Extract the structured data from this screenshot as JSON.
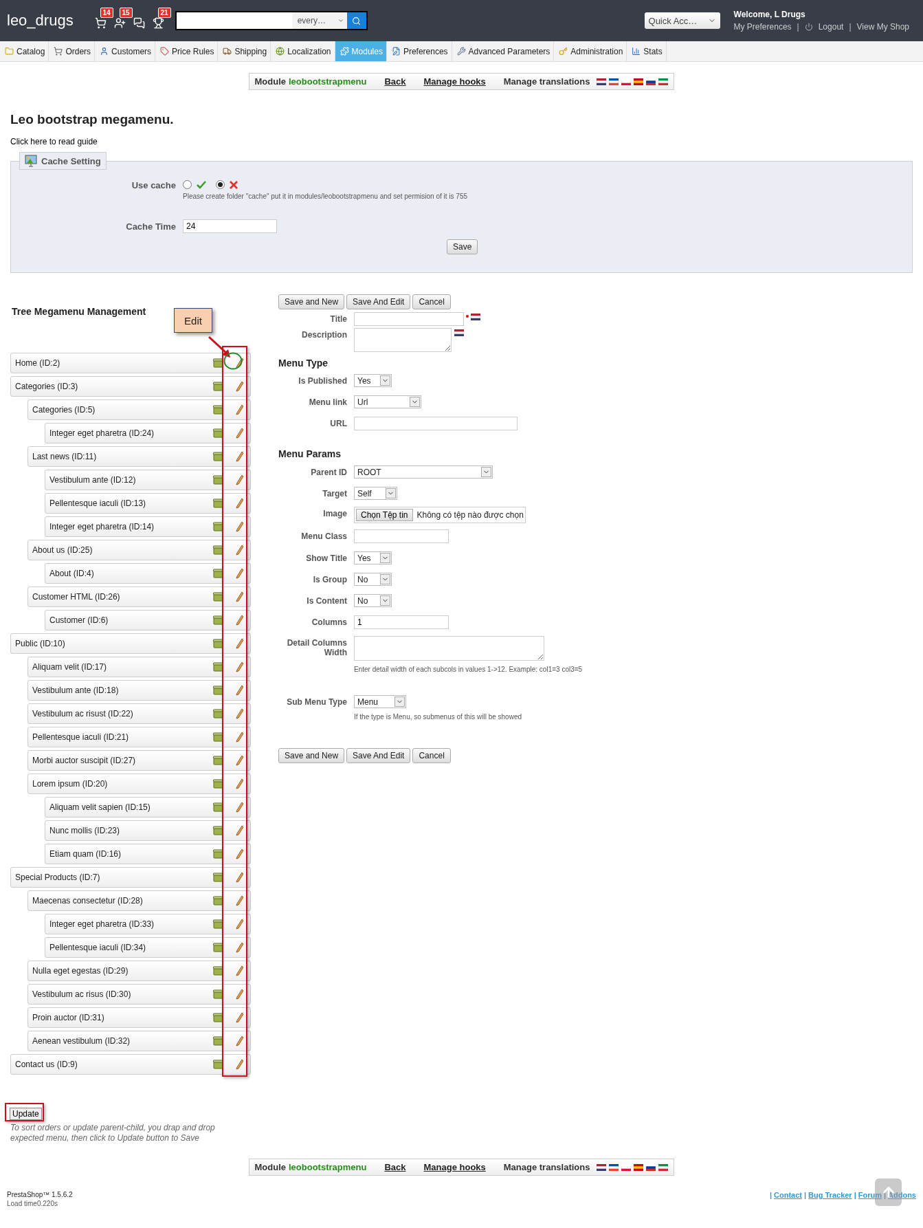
{
  "header": {
    "logo": "leo_drugs",
    "notifications": [
      {
        "kind": "cart",
        "count": "14"
      },
      {
        "kind": "customer",
        "count": "15"
      },
      {
        "kind": "message"
      },
      {
        "kind": "trophy",
        "count": "21"
      }
    ],
    "search": {
      "scope": "every…"
    },
    "quick_access": "Quick Acc…",
    "welcome": "Welcome, L Drugs",
    "separator": "|",
    "links": [
      "My Preferences",
      "Logout",
      "View My Shop"
    ]
  },
  "tabs": [
    {
      "label": "Catalog",
      "selected": false
    },
    {
      "label": "Orders",
      "selected": false
    },
    {
      "label": "Customers",
      "selected": false
    },
    {
      "label": "Price Rules",
      "selected": false
    },
    {
      "label": "Shipping",
      "selected": false
    },
    {
      "label": "Localization",
      "selected": false
    },
    {
      "label": "Modules",
      "selected": true
    },
    {
      "label": "Preferences",
      "selected": false
    },
    {
      "label": "Advanced Parameters",
      "selected": false
    },
    {
      "label": "Administration",
      "selected": false
    },
    {
      "label": "Stats",
      "selected": false
    }
  ],
  "module_bar_top": {
    "label": "Module",
    "module": "leobootstrapmenu",
    "links": [
      "Back",
      "Manage hooks"
    ],
    "translations": "Manage translations"
  },
  "title": "Leo bootstrap megamenu.",
  "guide_link": "Click here to read guide",
  "cache": {
    "legend": "Cache Setting",
    "use_cache_label": "Use cache",
    "options": [
      {
        "kind": "yes",
        "selected": false
      },
      {
        "kind": "no",
        "selected": true
      }
    ],
    "hint": "Please create folder \"cache\" put it in modules/leobootstrapmenu and set permision of it is 755",
    "time_label": "Cache Time",
    "time_value": "24",
    "save": "Save"
  },
  "tree": {
    "title": "Tree Megamenu Management",
    "items": [
      {
        "label": "Home (ID:2)"
      },
      {
        "label": "Categories (ID:3)",
        "children": [
          {
            "label": "Categories (ID:5)",
            "children": [
              {
                "label": "Integer eget pharetra (ID:24)"
              }
            ]
          },
          {
            "label": "Last news (ID:11)",
            "children": [
              {
                "label": "Vestibulum ante (ID:12)"
              },
              {
                "label": "Pellentesque iaculi (ID:13)"
              },
              {
                "label": "Integer eget pharetra (ID:14)"
              }
            ]
          },
          {
            "label": "About us (ID:25)",
            "children": [
              {
                "label": "About (ID:4)"
              }
            ]
          },
          {
            "label": "Customer HTML (ID:26)",
            "children": [
              {
                "label": "Customer (ID:6)"
              }
            ]
          }
        ]
      },
      {
        "label": "Public (ID:10)",
        "children": [
          {
            "label": "Aliquam velit (ID:17)"
          },
          {
            "label": "Vestibulum ante (ID:18)"
          },
          {
            "label": "Vestibulum ac risust (ID:22)"
          },
          {
            "label": "Pellentesque iaculi (ID:21)"
          },
          {
            "label": "Morbi auctor suscipit (ID:27)"
          },
          {
            "label": "Lorem ipsum (ID:20)",
            "children": [
              {
                "label": "Aliquam velit sapien (ID:15)"
              },
              {
                "label": "Nunc mollis (ID:23)"
              },
              {
                "label": "Etiam quam (ID:16)"
              }
            ]
          }
        ]
      },
      {
        "label": "Special Products (ID:7)",
        "children": [
          {
            "label": "Maecenas consectetur (ID:28)",
            "children": [
              {
                "label": "Integer eget pharetra (ID:33)"
              },
              {
                "label": "Pellentesque iaculi (ID:34)"
              }
            ]
          },
          {
            "label": "Nulla eget egestas (ID:29)"
          },
          {
            "label": "Vestibulum ac risus (ID:30)"
          },
          {
            "label": "Proin auctor (ID:31)"
          },
          {
            "label": "Aenean vestibulum (ID:32)"
          }
        ]
      },
      {
        "label": "Contact us (ID:9)"
      }
    ],
    "update": "Update",
    "note": "To sort orders or update parent-child, you drap and drop expected menu, then click to Update button to Save"
  },
  "callout": "Edit",
  "form": {
    "buttons_top": [
      "Save and New",
      "Save And Edit",
      "Cancel"
    ],
    "fields": [
      {
        "kind": "text",
        "label": "Title",
        "required": true,
        "flag": true
      },
      {
        "kind": "textarea",
        "label": "Description",
        "flag": true
      },
      {
        "kind": "heading",
        "label": "Menu Type"
      },
      {
        "kind": "select",
        "label": "Is Published",
        "value": "Yes"
      },
      {
        "kind": "select",
        "label": "Menu link",
        "value": "Url"
      },
      {
        "kind": "text",
        "label": "URL"
      },
      {
        "kind": "heading",
        "label": "Menu Params"
      },
      {
        "kind": "select",
        "label": "Parent ID",
        "value": "ROOT"
      },
      {
        "kind": "select",
        "label": "Target",
        "value": "Self"
      },
      {
        "kind": "file",
        "label": "Image",
        "button": "Chọn Tệp tin",
        "status": "Không có tệp nào được chọn"
      },
      {
        "kind": "text",
        "label": "Menu Class"
      },
      {
        "kind": "select",
        "label": "Show Title",
        "value": "Yes"
      },
      {
        "kind": "select",
        "label": "Is Group",
        "value": "No"
      },
      {
        "kind": "select",
        "label": "Is Content",
        "value": "No"
      },
      {
        "kind": "text",
        "label": "Columns",
        "value": "1"
      },
      {
        "kind": "textarea",
        "label": "Detail Columns Width",
        "hint": "Enter detail width of each subcols in values 1->12. Example: col1=3 col3=5"
      },
      {
        "kind": "select",
        "label": "Sub Menu Type",
        "value": "Menu",
        "hint": "If the type is Menu, so submenus of this will be showed"
      }
    ],
    "buttons_bottom": [
      "Save and New",
      "Save And Edit",
      "Cancel"
    ]
  },
  "module_bar_bottom": {
    "label": "Module",
    "module": "leobootstrapmenu",
    "links": [
      "Back",
      "Manage hooks"
    ],
    "translations": "Manage translations"
  },
  "footer": {
    "version": "PrestaShop™ 1.5.6.2",
    "load_time": "Load time0.220s",
    "separator": "|",
    "links": [
      "Contact",
      "Bug Tracker",
      "Forum",
      "Addons"
    ]
  }
}
